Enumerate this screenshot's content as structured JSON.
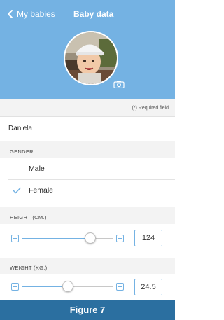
{
  "header": {
    "back_label": "My babies",
    "title": "Baby data",
    "icons": [
      "chevron-left-icon",
      "camera-icon"
    ],
    "color": "#74b2e3"
  },
  "form": {
    "required_note": "(*) Required field",
    "name_value": "Daniela",
    "gender": {
      "label": "GENDER",
      "options": [
        "Male",
        "Female"
      ],
      "selected": "Female"
    },
    "height": {
      "label": "HEIGHT (CM.)",
      "value": "124",
      "slider_level": 0.72
    },
    "weight": {
      "label": "WEIGHT (KG.)",
      "value": "24.5",
      "slider_level": 0.48
    }
  },
  "footer": {
    "caption": "Figure 7",
    "color": "#2b6fa0"
  }
}
